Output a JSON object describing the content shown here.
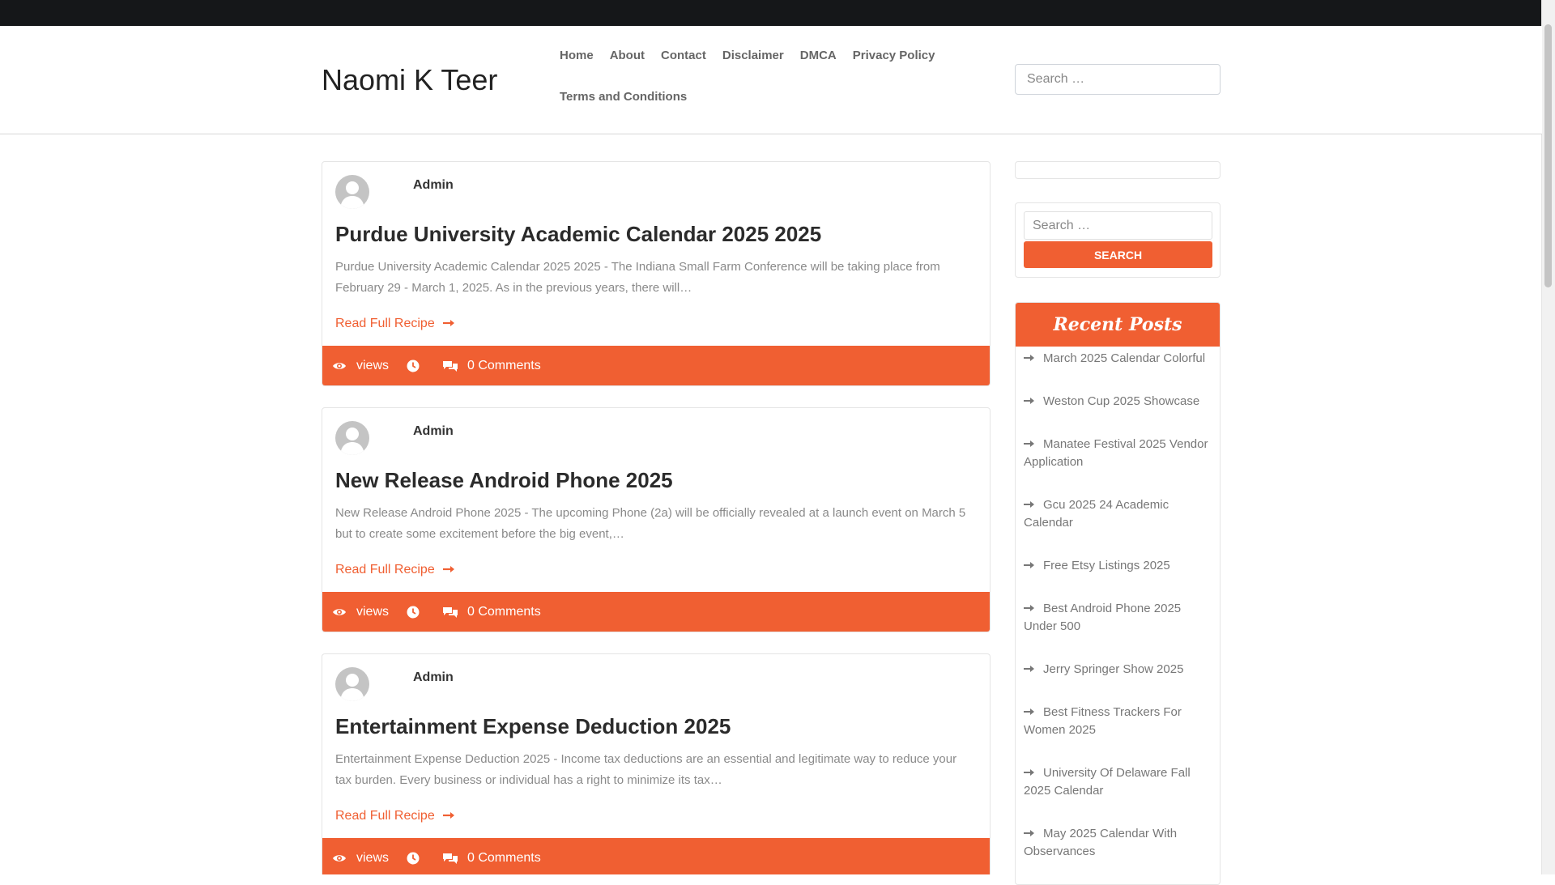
{
  "site": {
    "title": "Naomi K Teer"
  },
  "nav": [
    {
      "label": "Home"
    },
    {
      "label": "About"
    },
    {
      "label": "Contact"
    },
    {
      "label": "Disclaimer"
    },
    {
      "label": "DMCA"
    },
    {
      "label": "Privacy Policy"
    },
    {
      "label": "Terms and Conditions"
    }
  ],
  "header_search": {
    "placeholder": "Search …"
  },
  "posts": [
    {
      "author": "Admin",
      "title": "Purdue University Academic Calendar 2025 2025",
      "excerpt": "Purdue University Academic Calendar 2025 2025 - The Indiana Small Farm Conference will be taking place from February 29 - March 1, 2025. As in the previous years, there will…",
      "read_more": "Read Full Recipe",
      "views_label": "views",
      "comments": "0 Comments"
    },
    {
      "author": "Admin",
      "title": "New Release Android Phone 2025",
      "excerpt": "New Release Android Phone 2025 - The upcoming Phone (2a) will be officially revealed at a launch event on March 5 but to create some excitement before the big event,…",
      "read_more": "Read Full Recipe",
      "views_label": "views",
      "comments": "0 Comments"
    },
    {
      "author": "Admin",
      "title": "Entertainment Expense Deduction 2025",
      "excerpt": "Entertainment Expense Deduction 2025 - Income tax deductions are an essential and legitimate way to reduce your tax burden. Every business or individual has a right to minimize its tax…",
      "read_more": "Read Full Recipe",
      "views_label": "views",
      "comments": "0 Comments"
    }
  ],
  "sidebar": {
    "search": {
      "placeholder": "Search …",
      "button": "Search"
    },
    "recent": {
      "title": "Recent Posts",
      "items": [
        "March 2025 Calendar Colorful",
        "Weston Cup 2025 Showcase",
        "Manatee Festival 2025 Vendor Application",
        "Gcu 2025 24 Academic Calendar",
        "Free Etsy Listings 2025",
        "Best Android Phone 2025 Under 500",
        "Jerry Springer Show 2025",
        "Best Fitness Trackers For Women 2025",
        "University Of Delaware Fall 2025 Calendar",
        "May 2025 Calendar With Observances"
      ]
    }
  },
  "theme": {
    "accent": "#f05f32",
    "topbar": "#151719"
  },
  "icons": {
    "views": "eye-icon",
    "date": "clock-icon",
    "comments": "comments-icon",
    "read_more": "arrow-right-icon",
    "recent_item": "arrow-right-icon"
  }
}
